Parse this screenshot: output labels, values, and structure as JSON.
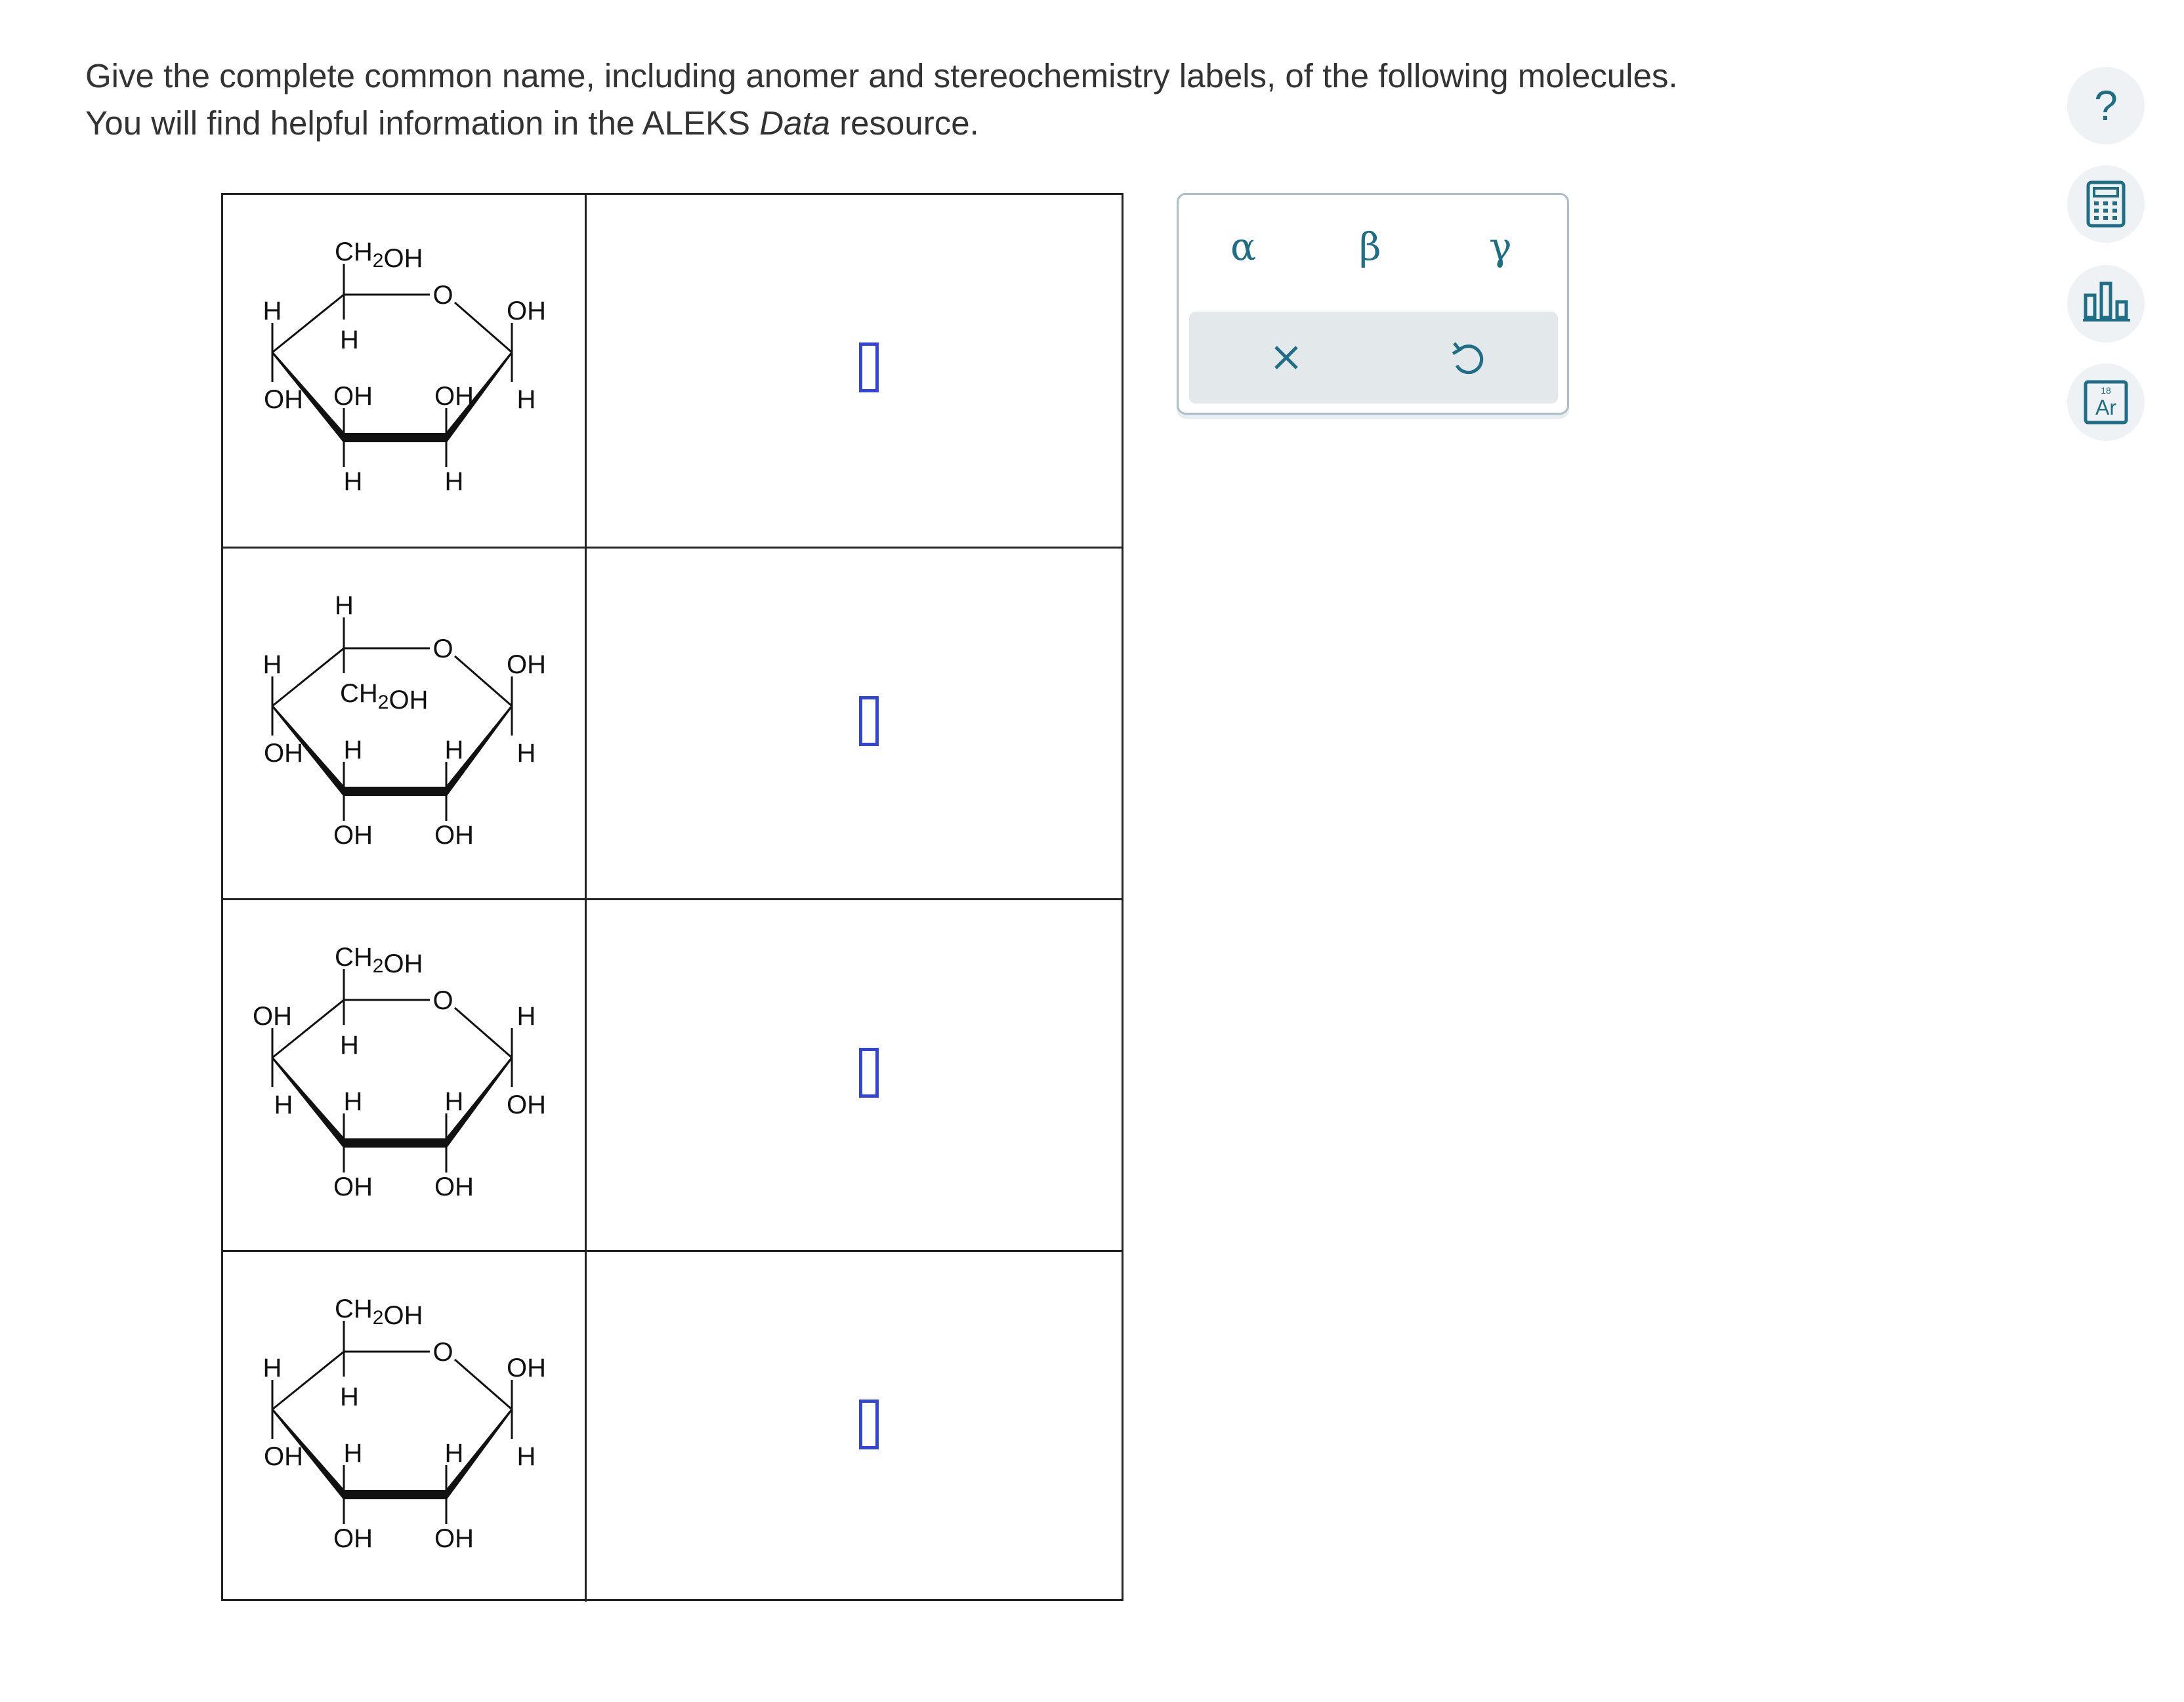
{
  "prompt": {
    "line1": "Give the complete common name, including anomer and stereochemistry labels, of the following molecules.",
    "line2_before": "You will find helpful information in the ALEKS ",
    "line2_em": "Data",
    "line2_after": " resource."
  },
  "molecules": [
    {
      "top_label": "CH2OH",
      "c5_down": "H",
      "o": "O",
      "c1_up": "OH",
      "c1_down": "H",
      "c4_up": "H",
      "c4_down": "OH",
      "c3_up": "OH",
      "c3_down": "H",
      "c2_up": "OH",
      "c2_down": "H",
      "answer": ""
    },
    {
      "top_label": "H",
      "c5_down": "CH2OH",
      "o": "O",
      "c1_up": "OH",
      "c1_down": "H",
      "c4_up": "H",
      "c4_down": "OH",
      "c3_up": "H",
      "c3_down": "OH",
      "c2_up": "H",
      "c2_down": "OH",
      "answer": ""
    },
    {
      "top_label": "CH2OH",
      "c5_down": "H",
      "o": "O",
      "c1_up": "H",
      "c1_down": "OH",
      "c4_up": "OH",
      "c4_down": "H",
      "c3_up": "H",
      "c3_down": "OH",
      "c2_up": "H",
      "c2_down": "OH",
      "answer": ""
    },
    {
      "top_label": "CH2OH",
      "c5_down": "H",
      "o": "O",
      "c1_up": "OH",
      "c1_down": "H",
      "c4_up": "H",
      "c4_down": "OH",
      "c3_up": "H",
      "c3_down": "OH",
      "c2_up": "H",
      "c2_down": "OH",
      "answer": ""
    }
  ],
  "palette": {
    "symbols": [
      "α",
      "β",
      "γ"
    ],
    "clear_icon": "x-icon",
    "undo_icon": "undo-icon"
  },
  "tools": [
    "help-icon",
    "calculator-icon",
    "bar-chart-icon",
    "periodic-table-icon"
  ],
  "tool_labels": {
    "help": "?",
    "periodic_number": "18",
    "periodic_symbol": "Ar"
  },
  "colors": {
    "accent": "#1f6e86",
    "answer_box": "#3344dd",
    "palette_border": "#aebdc6"
  }
}
